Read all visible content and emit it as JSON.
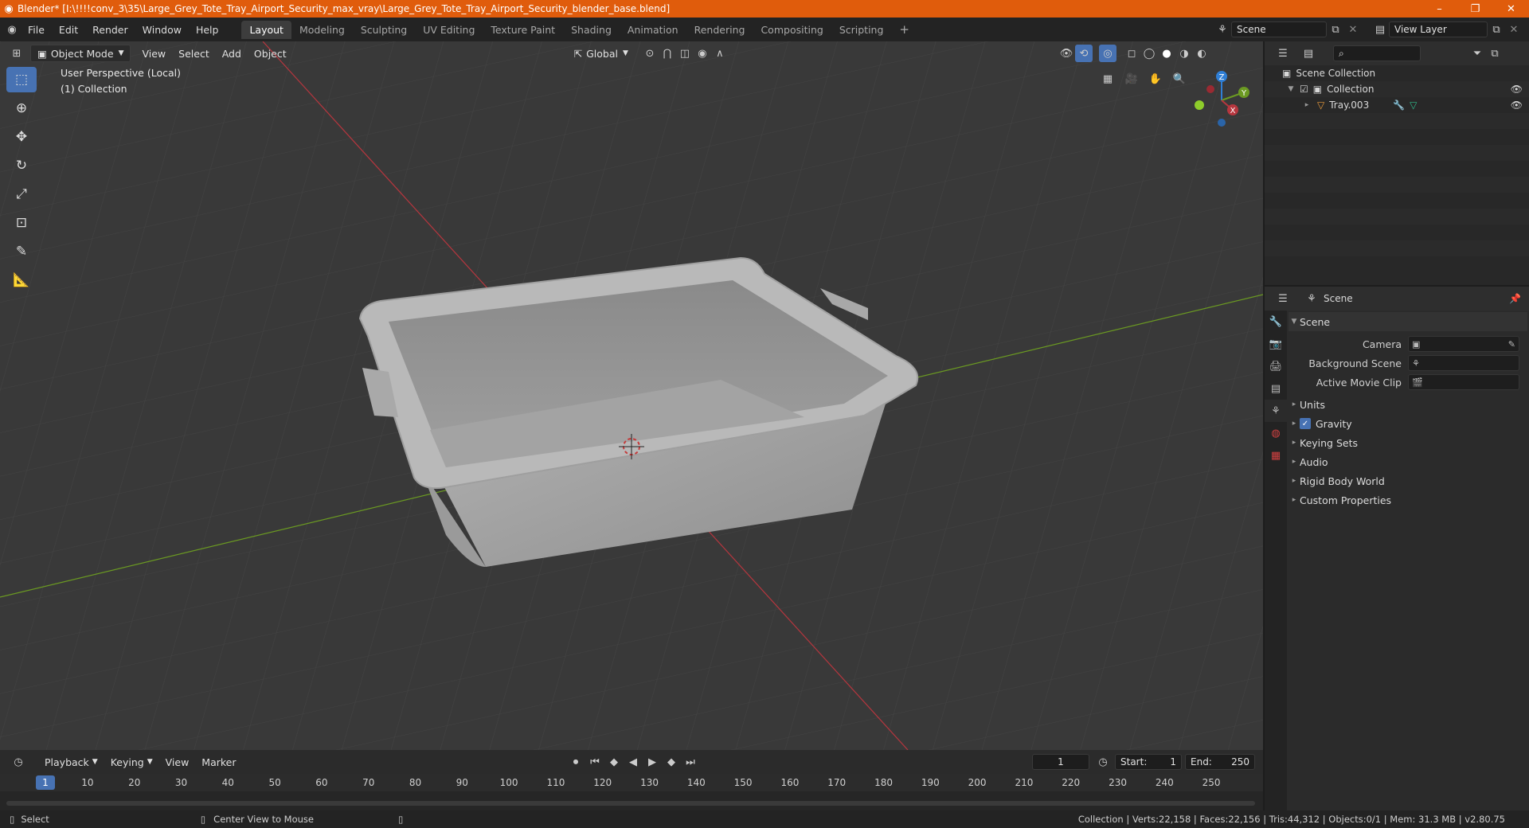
{
  "window": {
    "title": "Blender* [I:\\!!!!conv_3\\35\\Large_Grey_Tote_Tray_Airport_Security_max_vray\\Large_Grey_Tote_Tray_Airport_Security_blender_base.blend]",
    "controls": {
      "minimize": "–",
      "maximize": "❐",
      "close": "✕"
    }
  },
  "menu": {
    "items": [
      "File",
      "Edit",
      "Render",
      "Window",
      "Help"
    ],
    "workspaces": [
      "Layout",
      "Modeling",
      "Sculpting",
      "UV Editing",
      "Texture Paint",
      "Shading",
      "Animation",
      "Rendering",
      "Compositing",
      "Scripting"
    ],
    "active_workspace": "Layout",
    "add_workspace": "+",
    "scene": "Scene",
    "view_layer": "View Layer"
  },
  "viewport": {
    "mode": "Object Mode",
    "menus": [
      "View",
      "Select",
      "Add",
      "Object"
    ],
    "orientation": "Global",
    "perspective_label": "User Perspective (Local)",
    "collection_label": "(1) Collection",
    "gizmo": {
      "x": "X",
      "y": "Y",
      "z": "Z"
    }
  },
  "outliner": {
    "root": "Scene Collection",
    "collection": "Collection",
    "object": "Tray.003"
  },
  "properties": {
    "context": "Scene",
    "panel_title": "Scene",
    "fields": [
      {
        "label": "Camera",
        "value": ""
      },
      {
        "label": "Background Scene",
        "value": ""
      },
      {
        "label": "Active Movie Clip",
        "value": ""
      }
    ],
    "sections": [
      "Units",
      "Gravity",
      "Keying Sets",
      "Audio",
      "Rigid Body World",
      "Custom Properties"
    ],
    "gravity_checked": true
  },
  "timeline": {
    "menus": [
      "Playback",
      "Keying",
      "View",
      "Marker"
    ],
    "current_frame": "1",
    "start_label": "Start:",
    "start": "1",
    "end_label": "End:",
    "end": "250",
    "ticks": [
      "10",
      "20",
      "30",
      "40",
      "50",
      "60",
      "70",
      "80",
      "90",
      "100",
      "110",
      "120",
      "130",
      "140",
      "150",
      "160",
      "170",
      "180",
      "190",
      "200",
      "210",
      "220",
      "230",
      "240",
      "250"
    ]
  },
  "status": {
    "left_action": "Select",
    "middle_action": "Center View to Mouse",
    "stats": "Collection | Verts:22,158 | Faces:22,156 | Tris:44,312 | Objects:0/1 | Mem: 31.3 MB | v2.80.75"
  },
  "colors": {
    "accent": "#4772b3",
    "titlebar": "#e05c0c",
    "x_axis": "#b7363e",
    "y_axis": "#6b9a22",
    "z_axis": "#2f7fd6"
  }
}
